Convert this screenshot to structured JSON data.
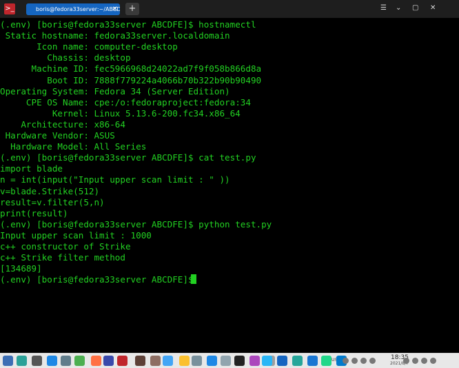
{
  "window": {
    "tab_title": "boris@fedora33server:~/ABCDFE",
    "tab_close": "✕",
    "new_tab": "+",
    "minimize": "⌄",
    "maximize": "▢",
    "close": "✕",
    "menu": "☰"
  },
  "terminal": {
    "lines": [
      "(.env) [boris@fedora33server ABCDFE]$ hostnamectl",
      " Static hostname: fedora33server.localdomain",
      "       Icon name: computer-desktop",
      "         Chassis: desktop",
      "      Machine ID: fec5966968d24022ad7f9f058b866d8a",
      "         Boot ID: 7888f779224a4066b70b322b90b90490",
      "Operating System: Fedora 34 (Server Edition)",
      "     CPE OS Name: cpe:/o:fedoraproject:fedora:34",
      "          Kernel: Linux 5.13.6-200.fc34.x86_64",
      "    Architecture: x86-64",
      " Hardware Vendor: ASUS",
      "  Hardware Model: All Series",
      "(.env) [boris@fedora33server ABCDFE]$ cat test.py",
      "import blade",
      "n = int(input(\"Input upper scan limit : \" ))",
      "v=blade.Strike(512)",
      "result=v.filter(5,n)",
      "print(result)",
      "(.env) [boris@fedora33server ABCDFE]$ python test.py",
      "Input upper scan limit : 1000",
      "c++ constructor of Strike",
      "c++ Strike filter method",
      "[134689]",
      "(.env) [boris@fedora33server ABCDFE]$ "
    ],
    "text_color": "#22d122"
  },
  "taskbar": {
    "apps": [
      {
        "name": "fedora-logo-icon",
        "color": "#3c6eb4"
      },
      {
        "name": "files-icon",
        "color": "#2aa198"
      },
      {
        "name": "window-icon",
        "color": "#555555"
      },
      {
        "name": "store-icon",
        "color": "#1e88e5"
      },
      {
        "name": "settings-icon",
        "color": "#607d8b"
      },
      {
        "name": "chrome-icon",
        "color": "#4caf50"
      },
      {
        "name": "firefox-icon",
        "color": "#ff7043"
      },
      {
        "name": "virtualbox-icon",
        "color": "#3949ab"
      },
      {
        "name": "terminal-icon",
        "color": "#c0262c"
      },
      {
        "name": "vm-icon",
        "color": "#5d4037"
      },
      {
        "name": "system-monitor-icon",
        "color": "#8d6e63"
      },
      {
        "name": "network-icon",
        "color": "#42a5f5"
      },
      {
        "name": "notes-icon",
        "color": "#fbc02d"
      },
      {
        "name": "editor-icon",
        "color": "#78909c"
      },
      {
        "name": "apps-grid-icon",
        "color": "#1e88e5"
      },
      {
        "name": "calendar-icon",
        "color": "#90a4ae"
      },
      {
        "name": "jetbrains-icon",
        "color": "#222222"
      },
      {
        "name": "shotwell-icon",
        "color": "#ab47bc"
      },
      {
        "name": "image-viewer-icon",
        "color": "#9e9e9e"
      },
      {
        "name": "wireshark-icon",
        "color": "#1565c0"
      },
      {
        "name": "photos-icon",
        "color": "#26a69a"
      },
      {
        "name": "word-icon",
        "color": "#1976d2"
      },
      {
        "name": "pycharm-icon",
        "color": "#21d789"
      },
      {
        "name": "vscode-icon",
        "color": "#007acc"
      },
      {
        "name": "telegram-icon",
        "color": "#29b6f6"
      }
    ],
    "ime": "US",
    "time": "18:35",
    "date": "2021/8/7"
  }
}
